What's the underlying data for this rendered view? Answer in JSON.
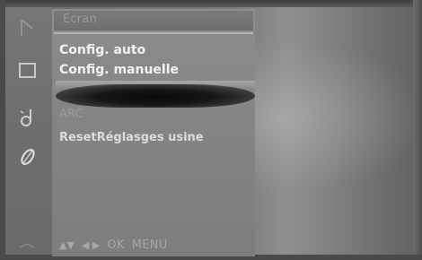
{
  "menu": {
    "title": "Ecran",
    "items": [
      {
        "label": "Config. auto",
        "state": "normal"
      },
      {
        "label": "Config. manuelle",
        "state": "normal"
      },
      {
        "label": "",
        "state": "selected"
      },
      {
        "label": "ARC",
        "state": "disabled"
      },
      {
        "label": "ResetRéglasges usine",
        "state": "normal"
      }
    ]
  },
  "nav": {
    "up_down": "▲▼",
    "left_right": "◀ ▶",
    "ok": "OK",
    "menu": "MENU"
  },
  "icons": [
    "picture-icon",
    "screen-icon",
    "audio-icon",
    "option-icon",
    "input-icon"
  ],
  "colors": {
    "text_primary": "#f2f2f2",
    "text_disabled": "#9a9a9a",
    "panel": "#878787",
    "selection": "#0a0a0a"
  }
}
